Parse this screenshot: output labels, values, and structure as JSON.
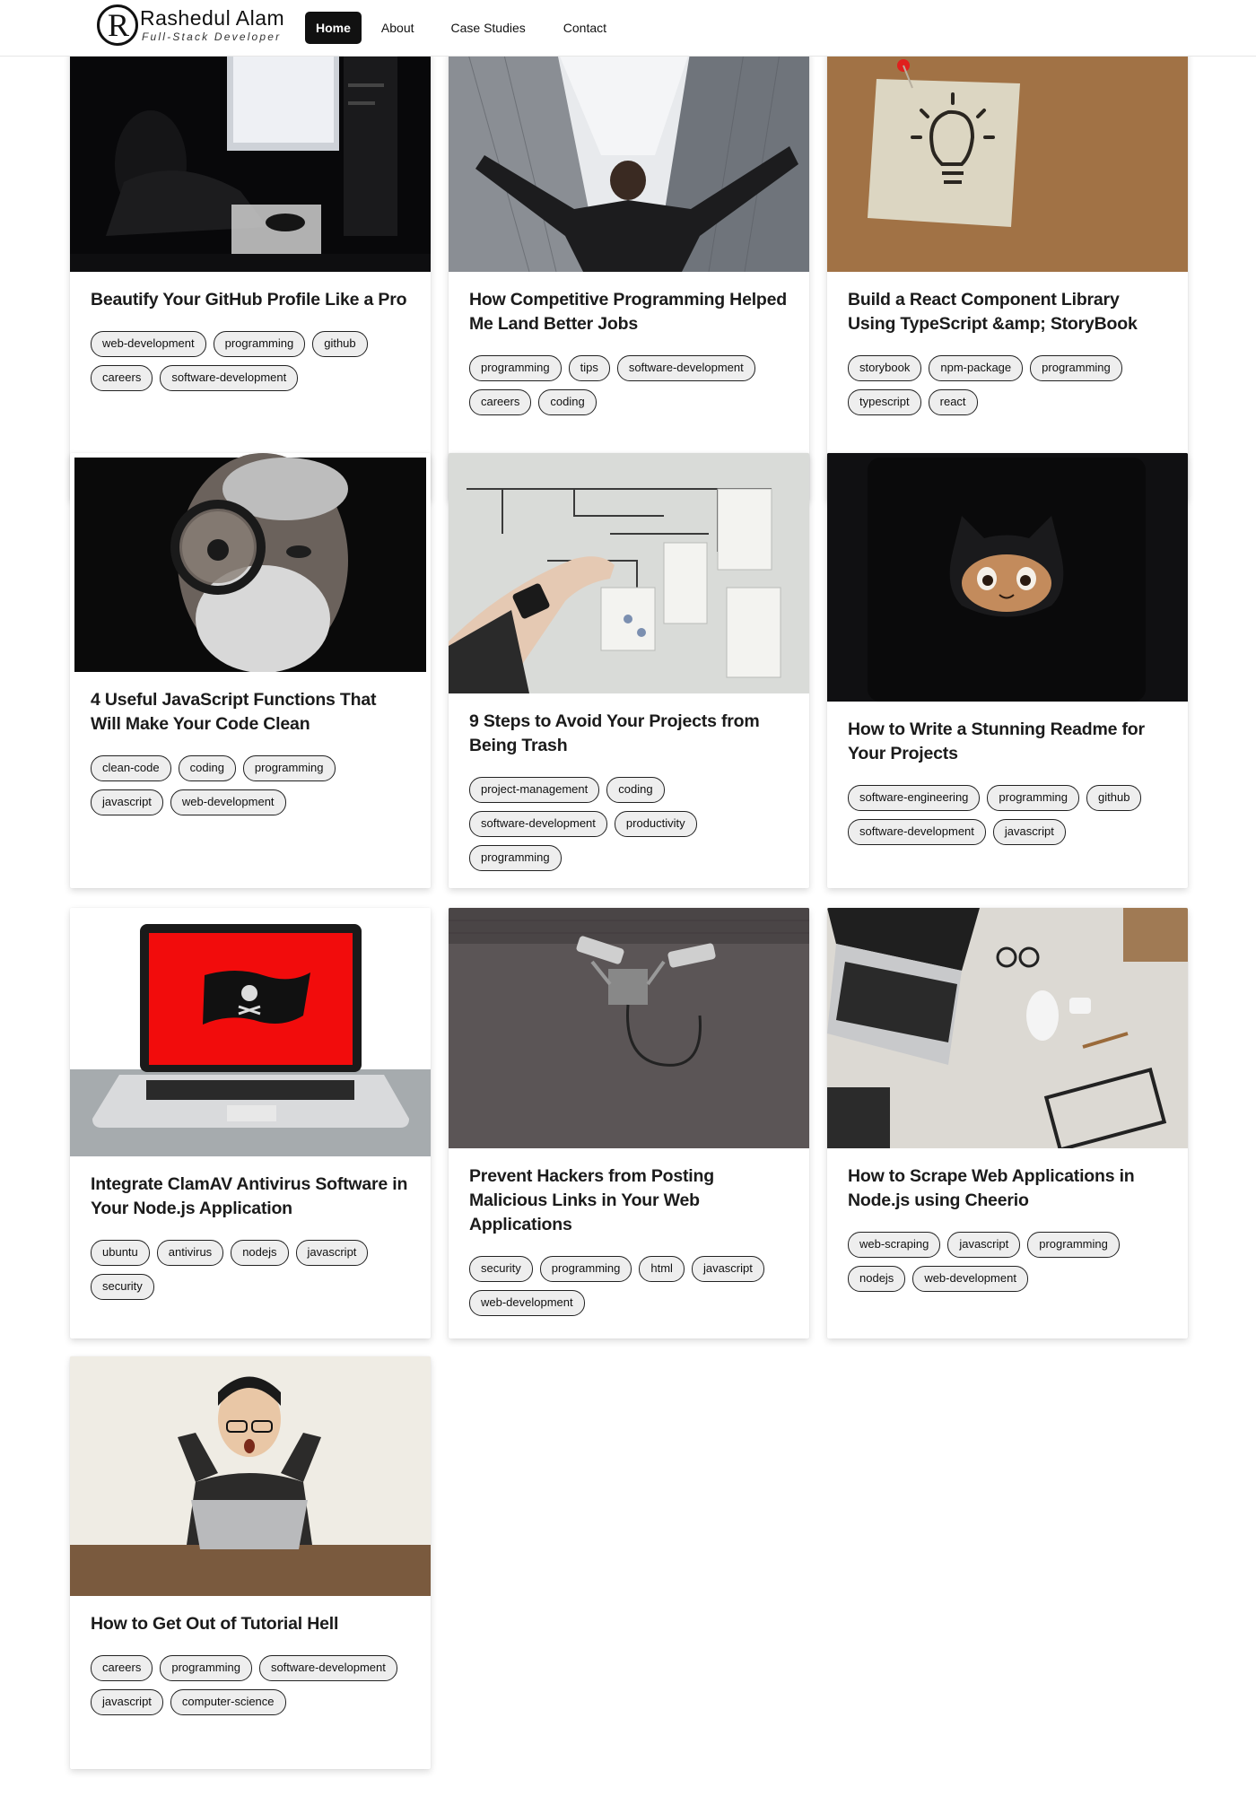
{
  "header": {
    "logo_letter": "R",
    "brand_name": "Rashedul Alam",
    "brand_tagline": "Full-Stack Developer",
    "nav": [
      {
        "label": "Home",
        "active": true
      },
      {
        "label": "About",
        "active": false
      },
      {
        "label": "Case Studies",
        "active": false
      },
      {
        "label": "Contact",
        "active": false
      }
    ]
  },
  "posts": [
    {
      "title": "Beautify Your GitHub Profile Like a Pro",
      "image": "dark-desk-monitor-photo",
      "tags": [
        "web-development",
        "programming",
        "github",
        "careers",
        "software-development"
      ]
    },
    {
      "title": "How Competitive Programming Helped Me Land Better Jobs",
      "image": "man-arms-raised-skyscrapers-photo",
      "tags": [
        "programming",
        "tips",
        "software-development",
        "careers",
        "coding"
      ]
    },
    {
      "title": "Build a React Component Library Using TypeScript &amp; StoryBook",
      "image": "lightbulb-sticky-note-corkboard-photo",
      "tags": [
        "storybook",
        "npm-package",
        "programming",
        "typescript",
        "react"
      ]
    },
    {
      "title": "4 Useful JavaScript Functions That Will Make Your Code Clean",
      "image": "old-man-magnifying-glass-photo",
      "tags": [
        "clean-code",
        "coding",
        "programming",
        "javascript",
        "web-development"
      ]
    },
    {
      "title": "9 Steps to Avoid Your Projects from Being Trash",
      "image": "hand-on-planning-board-photo",
      "tags": [
        "project-management",
        "coding",
        "software-development",
        "productivity",
        "programming"
      ]
    },
    {
      "title": "How to Write a Stunning Readme for Your Projects",
      "image": "octocat-toy-photo",
      "tags": [
        "software-engineering",
        "programming",
        "github",
        "software-development",
        "javascript"
      ]
    },
    {
      "title": "Integrate ClamAV Antivirus Software in Your Node.js Application",
      "image": "laptop-pirate-flag-photo",
      "tags": [
        "ubuntu",
        "antivirus",
        "nodejs",
        "javascript",
        "security"
      ]
    },
    {
      "title": "Prevent Hackers from Posting Malicious Links in Your Web Applications",
      "image": "security-cameras-wall-photo",
      "tags": [
        "security",
        "programming",
        "html",
        "javascript",
        "web-development"
      ]
    },
    {
      "title": "How to Scrape Web Applications in Node.js using Cheerio",
      "image": "laptop-desk-flatlay-photo",
      "tags": [
        "web-scraping",
        "javascript",
        "programming",
        "nodejs",
        "web-development"
      ]
    },
    {
      "title": "How to Get Out of Tutorial Hell",
      "image": "shocked-man-laptop-photo",
      "tags": [
        "careers",
        "programming",
        "software-development",
        "javascript",
        "computer-science"
      ]
    }
  ]
}
